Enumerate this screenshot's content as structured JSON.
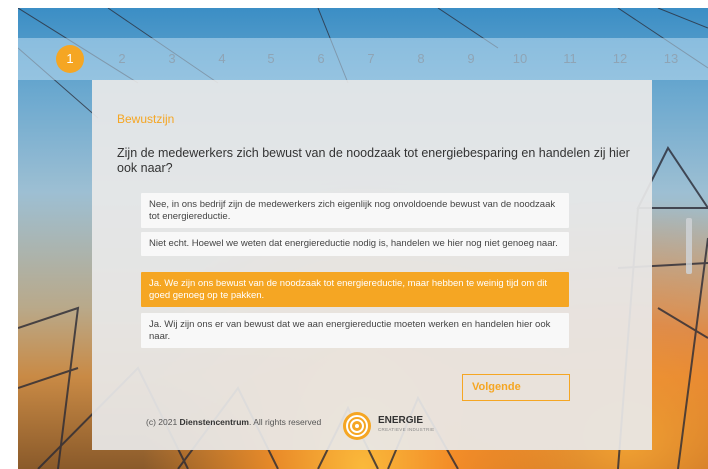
{
  "steps": [
    "1",
    "2",
    "3",
    "4",
    "5",
    "6",
    "7",
    "8",
    "9",
    "10",
    "11",
    "12",
    "13"
  ],
  "active_step": 1,
  "category": "Bewustzijn",
  "question": "Zijn de medewerkers zich bewust van de noodzaak tot energiebesparing en handelen zij hier ook naar?",
  "options": [
    {
      "text": "Nee, in ons bedrijf zijn de medewerkers zich eigenlijk nog onvoldoende bewust van de noodzaak tot energiereductie.",
      "selected": false
    },
    {
      "text": "Niet echt. Hoewel we weten dat energiereductie nodig is, handelen we hier nog niet genoeg naar.",
      "selected": false
    },
    {
      "text": "Ja. We zijn ons bewust van de noodzaak tot energiereductie, maar hebben te weinig tijd om dit goed genoeg op te pakken.",
      "selected": true
    },
    {
      "text": "Ja. Wij zijn ons er van bewust dat we aan energiereductie moeten werken en handelen hier ook naar.",
      "selected": false
    }
  ],
  "next_label": "Volgende",
  "footer": {
    "prefix": "(c) 2021 ",
    "company": "Dienstencentrum",
    "suffix": ". All rights reserved"
  },
  "logo": {
    "name": "ENERGIE",
    "sub": "CREATIEVE INDUSTRIE"
  },
  "colors": {
    "accent": "#f5a623"
  }
}
